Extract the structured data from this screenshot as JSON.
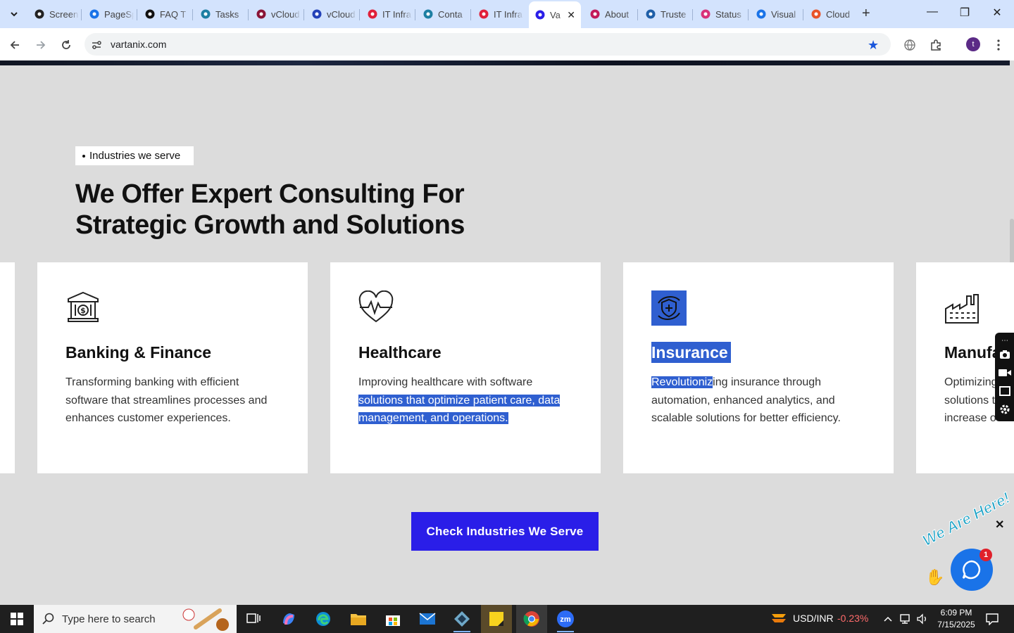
{
  "browser": {
    "tabs": [
      {
        "label": "Screen",
        "icon": "github-icon",
        "color": "#222222"
      },
      {
        "label": "PageSpeed",
        "icon": "pagespeed-icon",
        "color": "#1a73e8"
      },
      {
        "label": "FAQ T",
        "icon": "threads-icon",
        "color": "#111111"
      },
      {
        "label": "Tasks",
        "icon": "tasks-icon",
        "color": "#1d7fa3"
      },
      {
        "label": "vCloud",
        "icon": "v-logo-icon",
        "color": "#8a1538"
      },
      {
        "label": "vCloud",
        "icon": "check-logo-icon",
        "color": "#2442b8"
      },
      {
        "label": "IT Infra",
        "icon": "tag-icon",
        "color": "#e0203a"
      },
      {
        "label": "Conta",
        "icon": "contact-icon",
        "color": "#1d7fa3"
      },
      {
        "label": "IT Infra",
        "icon": "tag-icon",
        "color": "#e0203a"
      },
      {
        "label": "Va",
        "icon": "vartanix-icon",
        "color": "#2a1ee8",
        "active": true
      },
      {
        "label": "About",
        "icon": "about-icon",
        "color": "#c21a5a"
      },
      {
        "label": "Truste",
        "icon": "scale-icon",
        "color": "#1f5fa8"
      },
      {
        "label": "Status",
        "icon": "status-icon",
        "color": "#d8327a"
      },
      {
        "label": "Visual",
        "icon": "visual-icon",
        "color": "#1a73e8"
      },
      {
        "label": "Cloud",
        "icon": "cloud-icon",
        "color": "#e8542a"
      }
    ],
    "url": "vartanix.com",
    "profile_initial": "t"
  },
  "page": {
    "badge": "Industries we serve",
    "heading": "We Offer Expert Consulting For Strategic Growth and Solutions",
    "cards": [
      {
        "title": "Banking & Finance",
        "icon": "bank-icon",
        "desc_plain": "Transforming banking with efficient software that streamlines processes and enhances customer experiences.",
        "desc_highlight": ""
      },
      {
        "title": "Healthcare",
        "icon": "heartbeat-icon",
        "desc_plain": "Improving healthcare with software ",
        "desc_highlight": "solutions that optimize patient care, data management, and operations."
      },
      {
        "title": "Insurance",
        "icon": "insurance-icon",
        "desc_highlight_start": "Revolutioniz",
        "desc_plain": "ing insurance through automation, enhanced analytics, and scalable solutions for better efficiency."
      },
      {
        "title": "Manufa",
        "icon": "factory-icon",
        "desc_lines": [
          "Optimizing",
          "solutions t",
          "increase o"
        ]
      }
    ],
    "cta": "Check Industries We Serve",
    "chat": {
      "tagline": "We Are Here!",
      "unread": "1"
    }
  },
  "taskbar": {
    "search_placeholder": "Type here to search",
    "currency": "USD/INR",
    "currency_change": "-0.23%",
    "time": "6:09 PM",
    "date": "7/15/2025"
  },
  "colors": {
    "accent": "#2a1ee8",
    "highlight": "#2f5fd0",
    "negative": "#ff6b6b"
  }
}
